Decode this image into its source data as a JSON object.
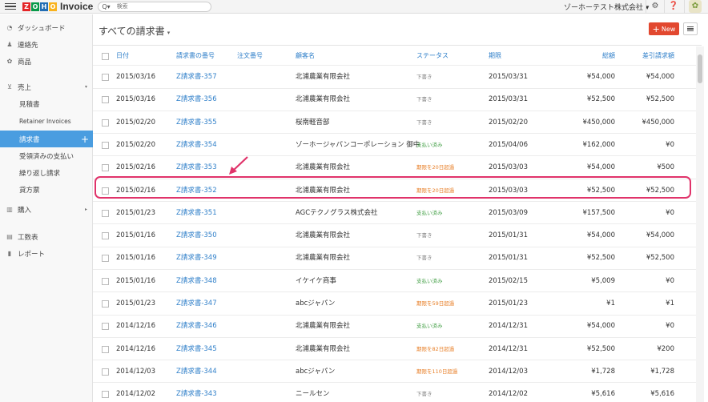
{
  "topbar": {
    "logo_letters": [
      "Z",
      "O",
      "H",
      "O"
    ],
    "logo_colors": [
      "#e42527",
      "#089949",
      "#226db4",
      "#f9b21d"
    ],
    "app_name": "Invoice",
    "search_placeholder": "検索",
    "org_name": "ゾーホーテスト株式会社 ▾"
  },
  "sidebar": {
    "items": [
      {
        "label": "ダッシュボード",
        "icon": "dashboard-icon"
      },
      {
        "label": "連絡先",
        "icon": "contacts-icon"
      },
      {
        "label": "商品",
        "icon": "items-icon"
      },
      {
        "label": "売上",
        "icon": "sales-icon"
      },
      {
        "label": "購入",
        "icon": "purchases-icon"
      },
      {
        "label": "工数表",
        "icon": "timesheet-icon"
      },
      {
        "label": "レポート",
        "icon": "reports-icon"
      }
    ],
    "sales_sub": [
      "見積書",
      "Retainer Invoices",
      "請求書",
      "受領済みの支払い",
      "繰り返し請求",
      "貸方票"
    ]
  },
  "main": {
    "title": "すべての請求書",
    "new_button": "New",
    "columns": [
      "日付",
      "請求書の番号",
      "注文番号",
      "顧客名",
      "ステータス",
      "期限",
      "総額",
      "差引請求額"
    ],
    "rows": [
      {
        "date": "2015/03/16",
        "number": "Z請求書-357",
        "order": "",
        "customer": "北浦農業有限会社",
        "status": "下書き",
        "status_type": "draft",
        "due": "2015/03/31",
        "total": "¥54,000",
        "balance": "¥54,000"
      },
      {
        "date": "2015/03/16",
        "number": "Z請求書-356",
        "order": "",
        "customer": "北浦農業有限会社",
        "status": "下書き",
        "status_type": "draft",
        "due": "2015/03/31",
        "total": "¥52,500",
        "balance": "¥52,500"
      },
      {
        "date": "2015/02/20",
        "number": "Z請求書-355",
        "order": "",
        "customer": "桜南軽音部",
        "status": "下書き",
        "status_type": "draft",
        "due": "2015/02/20",
        "total": "¥450,000",
        "balance": "¥450,000"
      },
      {
        "date": "2015/02/20",
        "number": "Z請求書-354",
        "order": "",
        "customer": "ゾーホージャパンコーポレーション 御中",
        "status": "支払い済み",
        "status_type": "paid",
        "due": "2015/04/06",
        "total": "¥162,000",
        "balance": "¥0"
      },
      {
        "date": "2015/02/16",
        "number": "Z請求書-353",
        "order": "",
        "customer": "北浦農業有限会社",
        "status": "期限を20日超過",
        "status_type": "overdue",
        "due": "2015/03/03",
        "total": "¥54,000",
        "balance": "¥500"
      },
      {
        "date": "2015/02/16",
        "number": "Z請求書-352",
        "order": "",
        "customer": "北浦農業有限会社",
        "status": "期限を20日超過",
        "status_type": "overdue",
        "due": "2015/03/03",
        "total": "¥52,500",
        "balance": "¥52,500"
      },
      {
        "date": "2015/01/23",
        "number": "Z請求書-351",
        "order": "",
        "customer": "AGCテクノグラス株式会社",
        "status": "支払い済み",
        "status_type": "paid",
        "due": "2015/03/09",
        "total": "¥157,500",
        "balance": "¥0"
      },
      {
        "date": "2015/01/16",
        "number": "Z請求書-350",
        "order": "",
        "customer": "北浦農業有限会社",
        "status": "下書き",
        "status_type": "draft",
        "due": "2015/01/31",
        "total": "¥54,000",
        "balance": "¥54,000"
      },
      {
        "date": "2015/01/16",
        "number": "Z請求書-349",
        "order": "",
        "customer": "北浦農業有限会社",
        "status": "下書き",
        "status_type": "draft",
        "due": "2015/01/31",
        "total": "¥52,500",
        "balance": "¥52,500"
      },
      {
        "date": "2015/01/16",
        "number": "Z請求書-348",
        "order": "",
        "customer": "イケイケ商事",
        "status": "支払い済み",
        "status_type": "paid",
        "due": "2015/02/15",
        "total": "¥5,009",
        "balance": "¥0"
      },
      {
        "date": "2015/01/23",
        "number": "Z請求書-347",
        "order": "",
        "customer": "abcジャパン",
        "status": "期限を59日超過",
        "status_type": "overdue",
        "due": "2015/01/23",
        "total": "¥1",
        "balance": "¥1"
      },
      {
        "date": "2014/12/16",
        "number": "Z請求書-346",
        "order": "",
        "customer": "北浦農業有限会社",
        "status": "支払い済み",
        "status_type": "paid",
        "due": "2014/12/31",
        "total": "¥54,000",
        "balance": "¥0"
      },
      {
        "date": "2014/12/16",
        "number": "Z請求書-345",
        "order": "",
        "customer": "北浦農業有限会社",
        "status": "期限を82日超過",
        "status_type": "overdue",
        "due": "2014/12/31",
        "total": "¥52,500",
        "balance": "¥200"
      },
      {
        "date": "2014/12/03",
        "number": "Z請求書-344",
        "order": "",
        "customer": "abcジャパン",
        "status": "期限を110日超過",
        "status_type": "overdue",
        "due": "2014/12/03",
        "total": "¥1,728",
        "balance": "¥1,728"
      },
      {
        "date": "2014/12/02",
        "number": "Z請求書-343",
        "order": "",
        "customer": "ニールセン",
        "status": "下書き",
        "status_type": "draft",
        "due": "2014/12/02",
        "total": "¥5,616",
        "balance": "¥5,616"
      }
    ]
  },
  "colors": {
    "accent": "#4a9de0",
    "new_button": "#e2482f",
    "highlight": "#e0336a",
    "paid": "#44a047",
    "overdue": "#e8802a"
  }
}
